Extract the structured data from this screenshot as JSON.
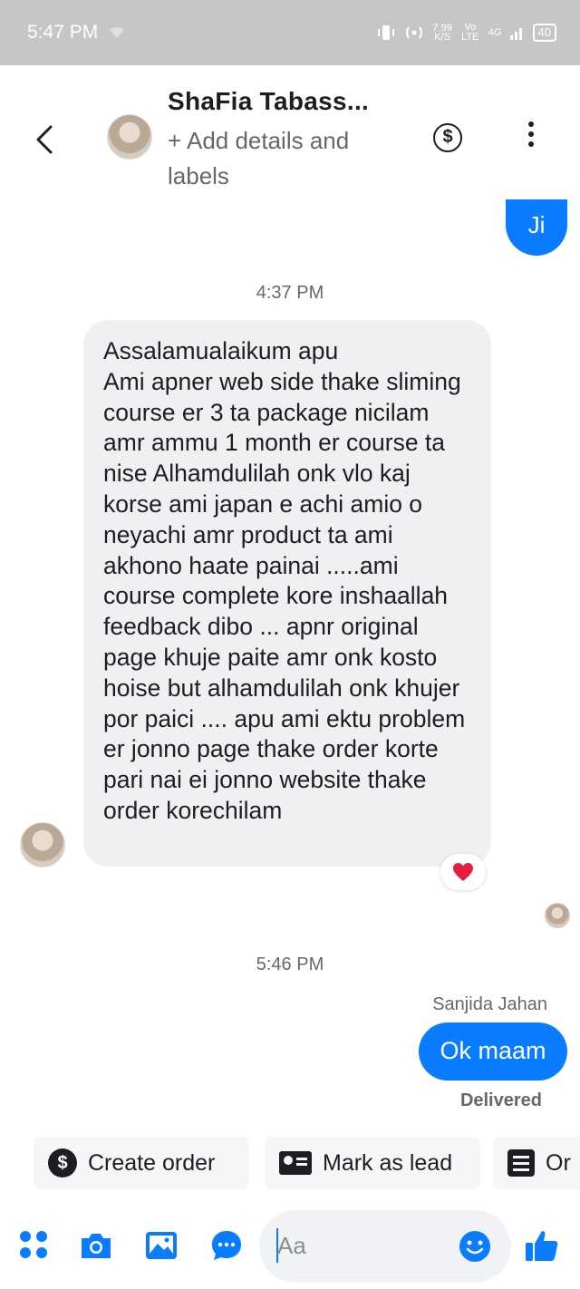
{
  "status_bar": {
    "time": "5:47 PM",
    "speed_value": "7.99",
    "speed_unit": "K/S",
    "network_a": "Vo LTE",
    "network_b": "4G",
    "battery": "40"
  },
  "header": {
    "contact_name": "ShaFia Tabass...",
    "add_details": "+ Add details and labels",
    "dollar_symbol": "$"
  },
  "messages": {
    "outgoing_1": "Ji",
    "timestamp_1": "4:37 PM",
    "incoming_1": "Assalamualaikum apu\nAmi apner web side thake sliming course er 3 ta package nicilam amr ammu 1 month er course ta nise Alhamdulilah onk vlo kaj korse ami japan e achi amio o neyachi amr product ta ami akhono haate painai .....ami course complete kore inshaallah feedback dibo ... apnr original page khuje paite amr onk kosto hoise but alhamdulilah onk khujer por paici ....  apu ami ektu problem er jonno page thake order korte pari nai ei jonno website thake order korechilam",
    "reaction": "❤️",
    "timestamp_2": "5:46 PM",
    "sender_name": "Sanjida Jahan",
    "outgoing_2": "Ok maam",
    "delivered": "Delivered"
  },
  "quick_actions": [
    {
      "label": "Create order",
      "icon": "dollar-icon"
    },
    {
      "label": "Mark as lead",
      "icon": "contact-card-icon"
    },
    {
      "label": "Or",
      "icon": "list-icon"
    }
  ],
  "composer": {
    "placeholder": "Aa",
    "icons": [
      "apps-icon",
      "camera-icon",
      "gallery-icon",
      "chat-bubble-icon",
      "emoji-icon",
      "thumbs-up-icon"
    ],
    "accent_color": "#0a7cff"
  }
}
